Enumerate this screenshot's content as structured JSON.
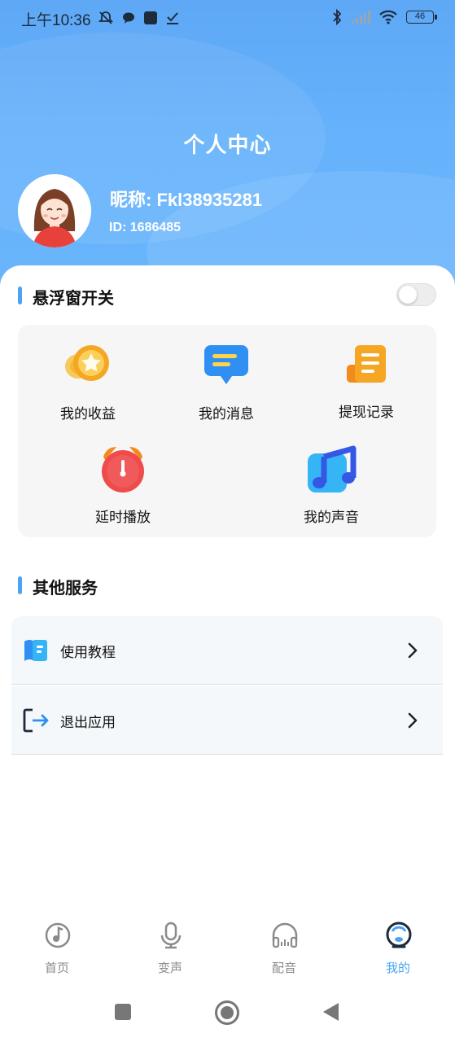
{
  "status_bar": {
    "time": "上午10:36",
    "battery": "46"
  },
  "header": {
    "title": "个人中心"
  },
  "profile": {
    "nickname": "昵称: Fkl38935281",
    "id": "ID: 1686485"
  },
  "floating_window": {
    "title": "悬浮窗开关",
    "toggle_on": false
  },
  "grid": {
    "items": [
      {
        "label": "我的收益",
        "icon": "coin-star-icon"
      },
      {
        "label": "我的消息",
        "icon": "message-bubble-icon"
      },
      {
        "label": "提现记录",
        "icon": "record-list-icon"
      },
      {
        "label": "延时播放",
        "icon": "alarm-clock-icon"
      },
      {
        "label": "我的声音",
        "icon": "music-note-icon"
      }
    ]
  },
  "other_services": {
    "title": "其他服务",
    "items": [
      {
        "label": "使用教程",
        "icon": "book-icon"
      },
      {
        "label": "退出应用",
        "icon": "logout-icon"
      }
    ]
  },
  "bottom_nav": {
    "items": [
      {
        "label": "首页",
        "icon": "music-disc-icon",
        "active": false
      },
      {
        "label": "变声",
        "icon": "microphone-icon",
        "active": false
      },
      {
        "label": "配音",
        "icon": "headphones-icon",
        "active": false
      },
      {
        "label": "我的",
        "icon": "profile-icon",
        "active": true
      }
    ]
  },
  "colors": {
    "accent": "#4aa3f4",
    "header_gradient_top": "#5ea8f6",
    "header_gradient_bottom": "#6ab6fd"
  }
}
